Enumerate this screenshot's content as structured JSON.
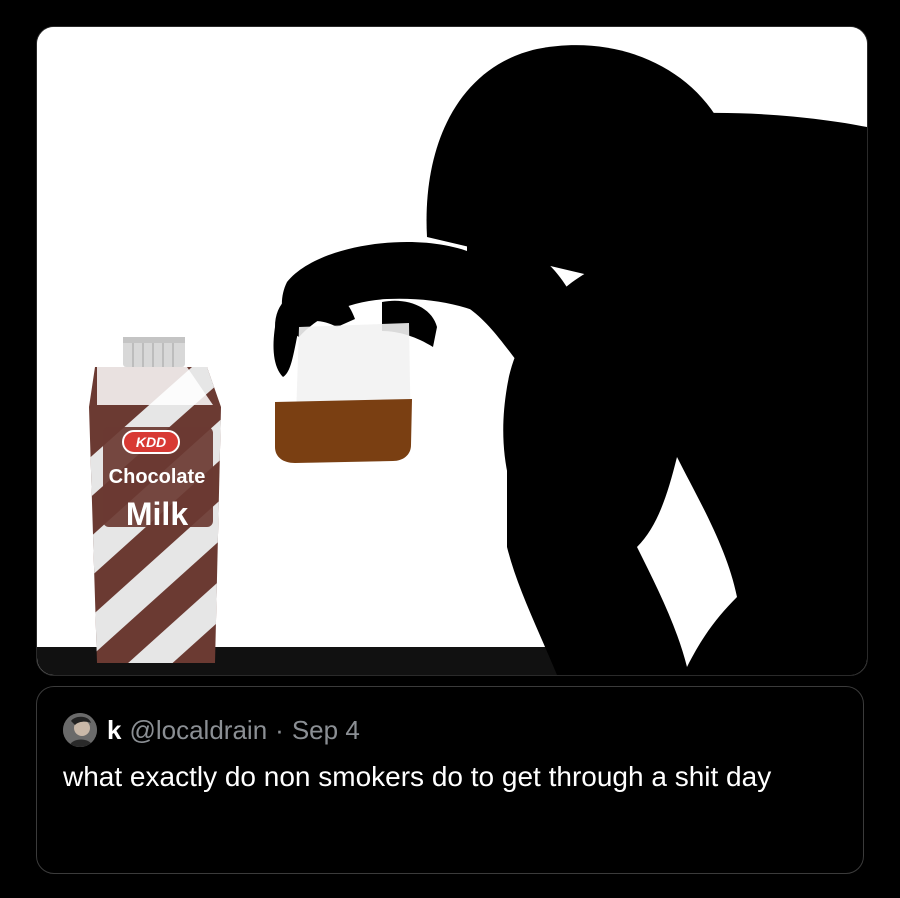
{
  "media": {
    "carton": {
      "brand": "KDD",
      "line1": "Chocolate",
      "line2": "Milk"
    }
  },
  "quote": {
    "display_name": "k",
    "handle": "@localdrain",
    "separator": "·",
    "date": "Sep 4",
    "text": "what exactly do non smokers do to get through a shit day"
  },
  "colors": {
    "background": "#000000",
    "border": "#3b3b3b",
    "muted_text": "#8b8f94",
    "chocolate_brown": "#6b3a32",
    "drink_brown": "#7a3f12"
  }
}
